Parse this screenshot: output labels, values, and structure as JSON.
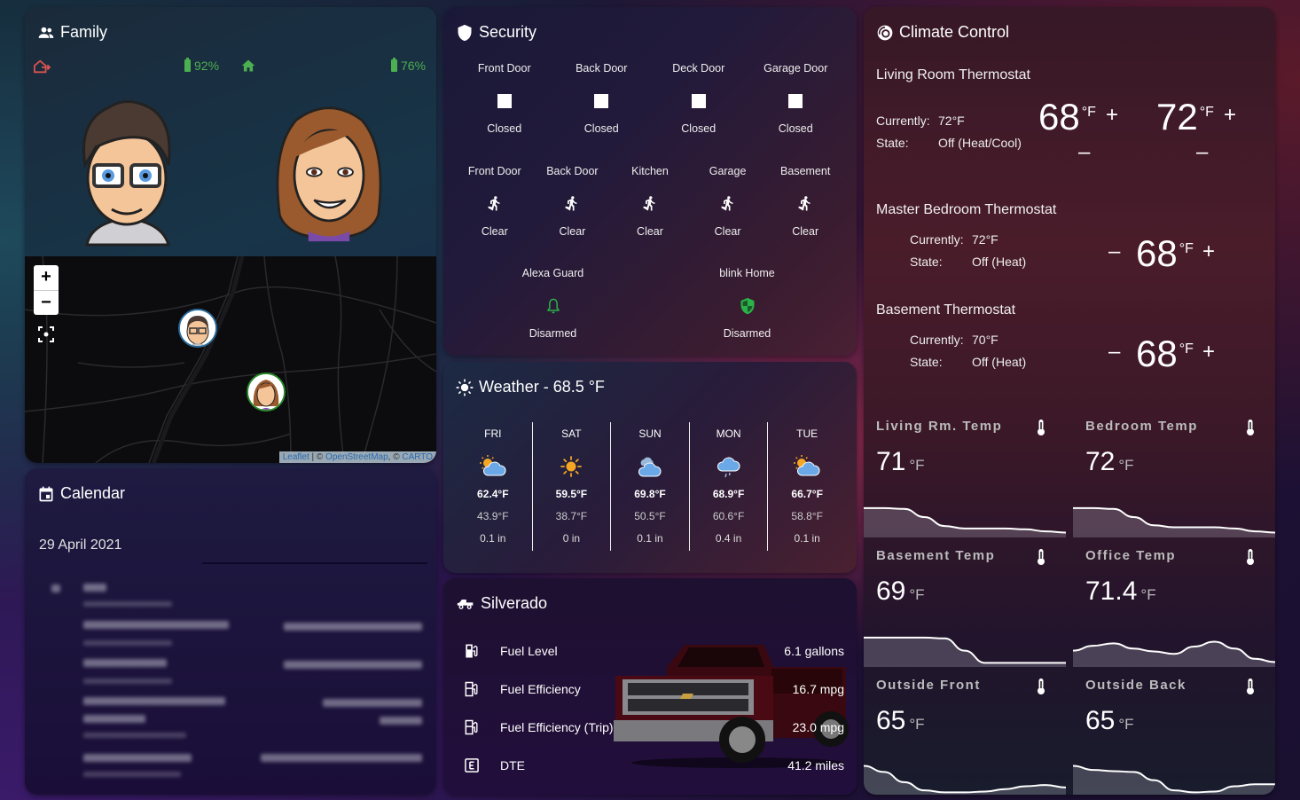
{
  "family": {
    "title": "Family",
    "icon": "account-group-icon",
    "members": [
      {
        "name": "person-1",
        "status_icon": "home-export-icon",
        "status": "away",
        "status_color": "#d9534f",
        "battery": "92%"
      },
      {
        "name": "person-2",
        "status_icon": "home-icon",
        "status": "home",
        "status_color": "#4caf50",
        "battery": "76%"
      }
    ],
    "map": {
      "zoom_in": "+",
      "zoom_out": "−",
      "attribution": {
        "leaflet": "Leaflet",
        "sep": " | © ",
        "osm": "OpenStreetMap",
        "sep2": ", © ",
        "carto": "CARTO"
      }
    }
  },
  "calendar": {
    "title": "Calendar",
    "date": "29 April 2021"
  },
  "security": {
    "title": "Security",
    "doors": [
      {
        "label": "Front Door",
        "state": "Closed"
      },
      {
        "label": "Back Door",
        "state": "Closed"
      },
      {
        "label": "Deck Door",
        "state": "Closed"
      },
      {
        "label": "Garage Door",
        "state": "Closed"
      }
    ],
    "motion": [
      {
        "label": "Front Door",
        "state": "Clear"
      },
      {
        "label": "Back Door",
        "state": "Clear"
      },
      {
        "label": "Kitchen",
        "state": "Clear"
      },
      {
        "label": "Garage",
        "state": "Clear"
      },
      {
        "label": "Basement",
        "state": "Clear"
      }
    ],
    "alarms": [
      {
        "label": "Alexa Guard",
        "state": "Disarmed",
        "icon": "bell-outline-icon"
      },
      {
        "label": "blink Home",
        "state": "Disarmed",
        "icon": "shield-half-full-icon"
      }
    ],
    "alarm_color": "#2bb34a"
  },
  "weather": {
    "title": "Weather - 68.5 °F",
    "forecast": [
      {
        "day": "FRI",
        "icon": "partly-cloudy-icon",
        "high": "62.4°F",
        "low": "43.9°F",
        "precip": "0.1 in"
      },
      {
        "day": "SAT",
        "icon": "sunny-icon",
        "high": "59.5°F",
        "low": "38.7°F",
        "precip": "0 in"
      },
      {
        "day": "SUN",
        "icon": "cloudy-icon",
        "high": "69.8°F",
        "low": "50.5°F",
        "precip": "0.1 in"
      },
      {
        "day": "MON",
        "icon": "rainy-icon",
        "high": "68.9°F",
        "low": "60.6°F",
        "precip": "0.4 in"
      },
      {
        "day": "TUE",
        "icon": "partly-cloudy-icon",
        "high": "66.7°F",
        "low": "58.8°F",
        "precip": "0.1 in"
      }
    ]
  },
  "silverado": {
    "title": "Silverado",
    "rows": [
      {
        "icon": "gas-station-icon",
        "label": "Fuel Level",
        "value": "6.1 gallons"
      },
      {
        "icon": "gas-station-outline-icon",
        "label": "Fuel Efficiency",
        "value": "16.7 mpg"
      },
      {
        "icon": "gas-station-outline-icon",
        "label": "Fuel Efficiency (Trip)",
        "value": "23.0 mpg"
      },
      {
        "icon": "alpha-e-box-icon",
        "label": "DTE",
        "value": "41.2 miles"
      }
    ]
  },
  "climate": {
    "title": "Climate Control",
    "thermostats": [
      {
        "name": "Living Room Thermostat",
        "currently_label": "Currently:",
        "currently": "72°F",
        "state_label": "State:",
        "state": "Off (Heat/Cool)",
        "setpoints": [
          "68",
          "72"
        ],
        "unit": "°F"
      },
      {
        "name": "Master Bedroom Thermostat",
        "currently_label": "Currently:",
        "currently": "72°F",
        "state_label": "State:",
        "state": "Off (Heat)",
        "setpoints": [
          "68"
        ],
        "unit": "°F"
      },
      {
        "name": "Basement Thermostat",
        "currently_label": "Currently:",
        "currently": "70°F",
        "state_label": "State:",
        "state": "Off (Heat)",
        "setpoints": [
          "68"
        ],
        "unit": "°F"
      }
    ],
    "plus": "+",
    "minus": "–",
    "sensors": [
      {
        "name": "Living Rm. Temp",
        "value": "71",
        "unit": "°F",
        "history": [
          0.72,
          0.72,
          0.7,
          0.5,
          0.28,
          0.22,
          0.22,
          0.22,
          0.2,
          0.15,
          0.12
        ]
      },
      {
        "name": "Bedroom Temp",
        "value": "72",
        "unit": "°F",
        "history": [
          0.72,
          0.72,
          0.7,
          0.5,
          0.3,
          0.25,
          0.25,
          0.25,
          0.22,
          0.15,
          0.12
        ]
      },
      {
        "name": "Basement Temp",
        "value": "69",
        "unit": "°F",
        "history": [
          0.72,
          0.72,
          0.72,
          0.72,
          0.7,
          0.4,
          0.1,
          0.1,
          0.1,
          0.1,
          0.1
        ]
      },
      {
        "name": "Office Temp",
        "value": "71.4",
        "unit": "°F",
        "history": [
          0.4,
          0.52,
          0.58,
          0.45,
          0.38,
          0.32,
          0.5,
          0.62,
          0.45,
          0.2,
          0.12
        ]
      },
      {
        "name": "Outside Front",
        "value": "65",
        "unit": "°F",
        "history": [
          0.75,
          0.6,
          0.35,
          0.15,
          0.1,
          0.1,
          0.12,
          0.18,
          0.25,
          0.28,
          0.22
        ]
      },
      {
        "name": "Outside Back",
        "value": "65",
        "unit": "°F",
        "history": [
          0.75,
          0.65,
          0.62,
          0.6,
          0.4,
          0.15,
          0.1,
          0.12,
          0.25,
          0.3,
          0.3
        ]
      }
    ]
  }
}
